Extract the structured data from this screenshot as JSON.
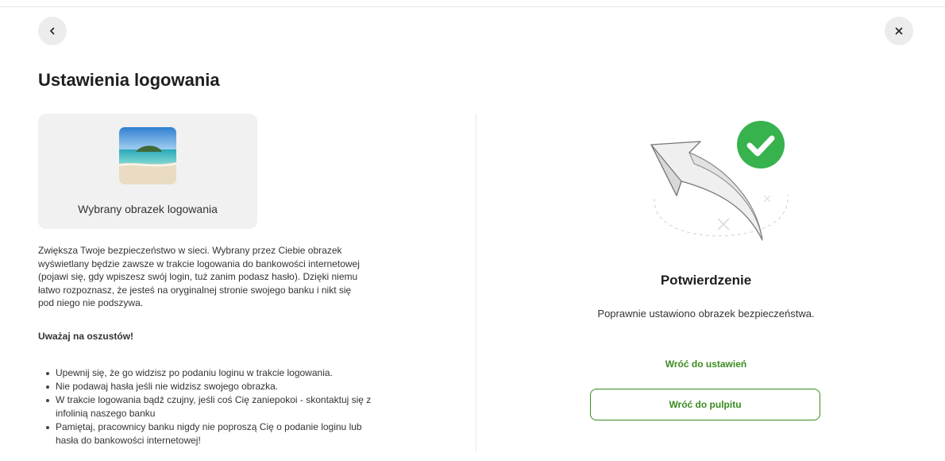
{
  "header": {
    "title": "Ustawienia logowania",
    "back_icon": "chevron-left-icon",
    "close_icon": "close-icon"
  },
  "image_card": {
    "caption": "Wybrany obrazek logowania",
    "image": "beach-island-picture"
  },
  "description": "Zwiększa Twoje bezpieczeństwo w sieci. Wybrany przez Ciebie obrazek wyświetlany będzie zawsze w trakcie logowania do bankowości internetowej (pojawi się, gdy wpiszesz swój login, tuż zanim podasz hasło). Dzięki niemu łatwo rozpoznasz, że jesteś na oryginalnej stronie swojego banku i nikt się pod niego nie podszywa.",
  "warning": {
    "title": "Uważaj na oszustów!",
    "tips": [
      "Upewnij się, że go widzisz po podaniu loginu w trakcie logowania.",
      "Nie podawaj hasła jeśli nie widzisz swojego obrazka.",
      "W trakcie logowania bądź czujny, jeśli coś Cię zaniepokoi - skontaktuj się z infolinią naszego banku",
      "Pamiętaj, pracownicy banku nigdy nie poproszą Cię o podanie loginu lub hasła do bankowości internetowej!"
    ]
  },
  "confirmation": {
    "title": "Potwierdzenie",
    "message": "Poprawnie ustawiono obrazek bezpieczeństwa.",
    "back_link": "Wróć do ustawień",
    "dashboard_button": "Wróć do pulpitu",
    "illustration": "arrow-checkmark-illustration"
  },
  "colors": {
    "accent": "#3a8c1f",
    "success": "#37b24d",
    "card_bg": "#f1f1f1"
  }
}
